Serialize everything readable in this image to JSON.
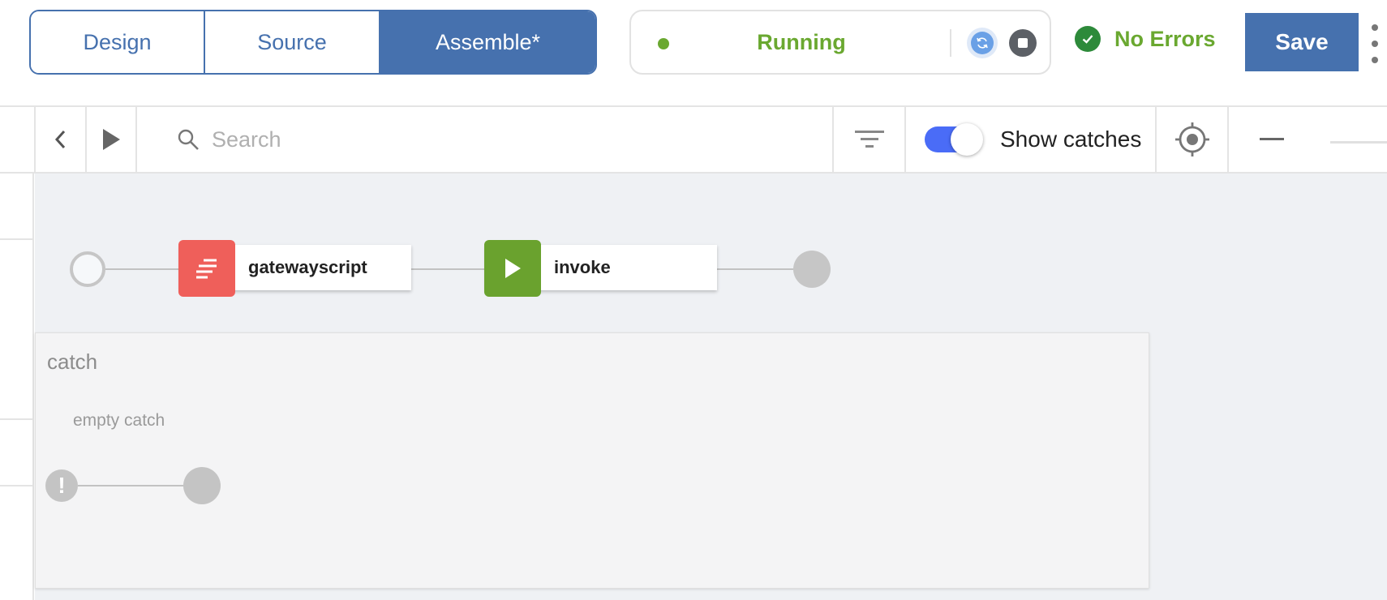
{
  "header": {
    "tabs": [
      {
        "label": "Design",
        "active": false
      },
      {
        "label": "Source",
        "active": false
      },
      {
        "label": "Assemble*",
        "active": true
      }
    ],
    "status": {
      "text": "Running",
      "color": "#6aa830"
    },
    "errors": {
      "text": "No Errors",
      "color": "#6aa830"
    },
    "save_label": "Save"
  },
  "toolbar": {
    "search_placeholder": "Search",
    "toggle": {
      "label": "Show catches",
      "on": true,
      "color": "#4a6cf7"
    }
  },
  "flow": {
    "policies": [
      {
        "label": "gatewayscript",
        "icon": "gatewayscript-icon",
        "color": "#ef5f5a"
      },
      {
        "label": "invoke",
        "icon": "play-icon",
        "color": "#6aa22e"
      }
    ]
  },
  "catch": {
    "title": "catch",
    "empty_label": "empty catch",
    "error_glyph": "!"
  },
  "colors": {
    "accent": "#4671ae"
  }
}
